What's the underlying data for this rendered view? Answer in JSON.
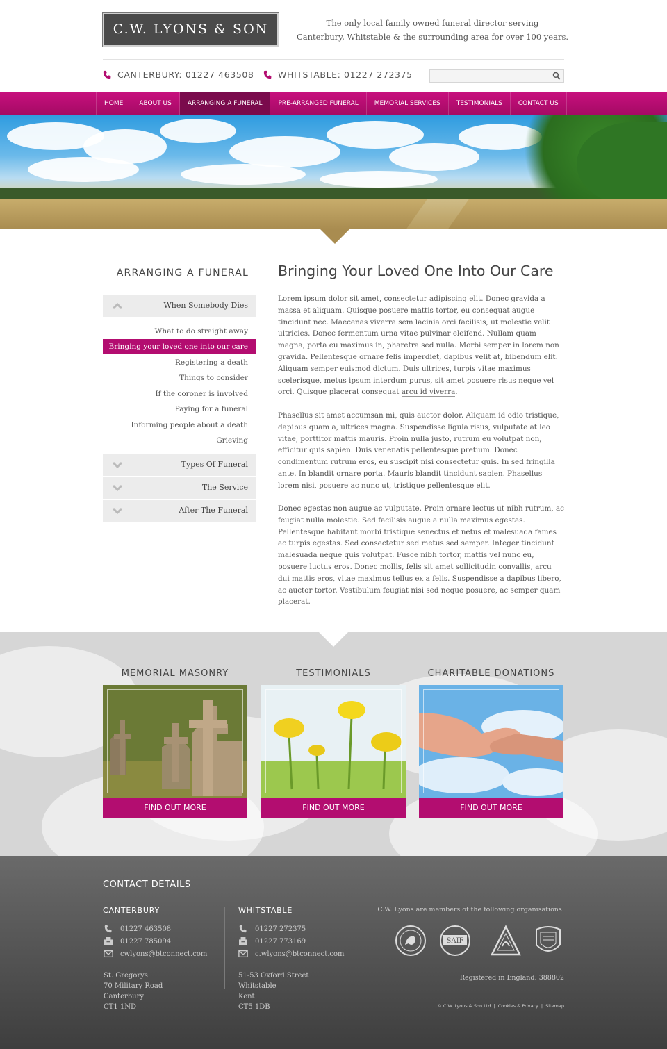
{
  "header": {
    "logo": "C.W. LYONS & SON",
    "tagline_line1": "The only local family owned funeral director serving",
    "tagline_line2": "Canterbury, Whitstable & the surrounding area for over 100 years.",
    "phone_canterbury": "CANTERBURY: 01227 463508",
    "phone_whitstable": "WHITSTABLE: 01227 272375",
    "search_placeholder": ""
  },
  "nav": {
    "items": [
      "HOME",
      "ABOUT US",
      "ARRANGING A FUNERAL",
      "PRE-ARRANGED FUNERAL",
      "MEMORIAL SERVICES",
      "TESTIMONIALS",
      "CONTACT US"
    ],
    "active": "ARRANGING A FUNERAL"
  },
  "sidebar": {
    "title": "ARRANGING A FUNERAL",
    "sections": [
      {
        "label": "When Somebody Dies",
        "expanded": true
      },
      {
        "label": "Types Of Funeral",
        "expanded": false
      },
      {
        "label": "The Service",
        "expanded": false
      },
      {
        "label": "After The Funeral",
        "expanded": false
      }
    ],
    "subitems": [
      "What to do straight away",
      "Bringing your loved one into our care",
      "Registering a death",
      "Things to consider",
      "If the coroner is involved",
      "Paying for a funeral",
      "Informing people about a death",
      "Grieving"
    ],
    "active_subitem": "Bringing your loved one into our care"
  },
  "content": {
    "title": "Bringing Your Loved One Into Our Care",
    "para1": "Lorem ipsum dolor sit amet, consectetur adipiscing elit. Donec gravida a massa et aliquam. Quisque posuere mattis tortor, eu consequat augue tincidunt nec. Maecenas viverra sem lacinia orci facilisis, ut molestie velit ultricies. Donec fermentum urna vitae pulvinar eleifend. Nullam quam magna, porta eu maximus in, pharetra sed nulla. Morbi semper in lorem non gravida. Pellentesque ornare felis imperdiet, dapibus velit at, bibendum elit. Aliquam semper euismod dictum. Duis ultrices, turpis vitae maximus scelerisque, metus ipsum interdum purus, sit amet posuere risus neque vel orci. Quisque placerat consequat ",
    "para1_link": "arcu id viverra",
    "para1_end": ".",
    "para2": "Phasellus sit amet accumsan mi, quis auctor dolor. Aliquam id odio tristique, dapibus quam a, ultrices magna. Suspendisse ligula risus, vulputate at leo vitae, porttitor mattis mauris. Proin nulla justo, rutrum eu volutpat non, efficitur quis sapien. Duis venenatis pellentesque pretium. Donec condimentum rutrum eros, eu suscipit nisi consectetur quis. In sed fringilla ante. In blandit ornare porta. Mauris blandit tincidunt sapien. Phasellus lorem nisi, posuere ac nunc ut, tristique pellentesque elit.",
    "para3": "Donec egestas non augue ac vulputate. Proin ornare lectus ut nibh rutrum, ac feugiat nulla molestie. Sed facilisis augue a nulla maximus egestas. Pellentesque habitant morbi tristique senectus et netus et malesuada fames ac turpis egestas. Sed consectetur sed metus sed semper. Integer tincidunt malesuada neque quis volutpat. Fusce nibh tortor, mattis vel nunc eu, posuere luctus eros. Donec mollis, felis sit amet sollicitudin convallis, arcu dui mattis eros, vitae maximus tellus ex a felis. Suspendisse a dapibus libero, ac auctor tortor. Vestibulum feugiat nisi sed neque posuere, ac semper quam placerat."
  },
  "promos": [
    {
      "title": "MEMORIAL MASONRY",
      "button": "FIND OUT MORE"
    },
    {
      "title": "TESTIMONIALS",
      "button": "FIND OUT MORE"
    },
    {
      "title": "CHARITABLE DONATIONS",
      "button": "FIND OUT MORE"
    }
  ],
  "footer": {
    "title": "CONTACT DETAILS",
    "canterbury": {
      "name": "CANTERBURY",
      "phone": "01227 463508",
      "fax": "01227 785094",
      "email": "cwlyons@btconnect.com",
      "address": [
        "St. Gregorys",
        "70 Military Road",
        "Canterbury",
        "CT1 1ND"
      ]
    },
    "whitstable": {
      "name": "WHITSTABLE",
      "phone": "01227 272375",
      "fax": "01227 773169",
      "email": "c.wlyons@btconnect.com",
      "address": [
        "51-53 Oxford Street",
        "Whitstable",
        "Kent",
        "CT5 1DB"
      ]
    },
    "members_text": "C.W. Lyons are members of the following organisations:",
    "badge_saif": "SAIF",
    "registered": "Registered in England: 388802",
    "copyright": "© C.W. Lyons & Son Ltd",
    "cookies": "Cookies & Privacy",
    "sitemap": "Sitemap"
  },
  "colors": {
    "brand_magenta": "#b30d70",
    "nav_active": "#7a0a4c",
    "logo_bg": "#4a4a4a"
  }
}
